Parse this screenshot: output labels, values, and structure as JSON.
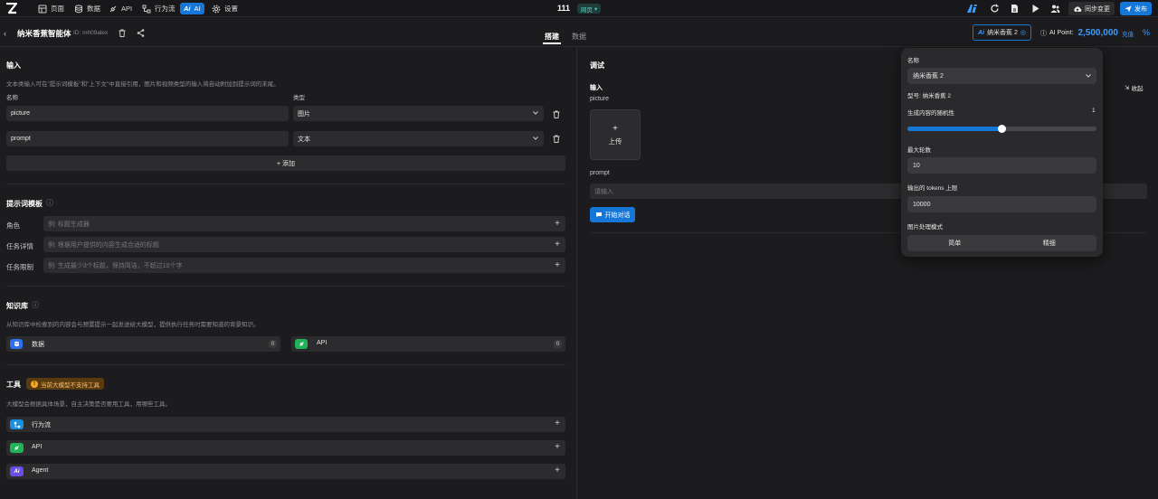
{
  "topbar": {
    "nav": [
      {
        "label": "页面",
        "icon": "pages-icon"
      },
      {
        "label": "数据",
        "icon": "database-icon"
      },
      {
        "label": "API",
        "icon": "api-icon"
      },
      {
        "label": "行为流",
        "icon": "workflow-icon"
      },
      {
        "label": "AI",
        "icon": "ai-icon"
      },
      {
        "label": "设置",
        "icon": "gear-icon"
      }
    ],
    "project": "111",
    "env_tag": "网页",
    "sync_label": "同步变更",
    "publish_label": "发布"
  },
  "subbar": {
    "agent_name": "纳米香蕉智能体",
    "agent_id": "ID: mh09alex",
    "tabs": [
      "搭建",
      "数据"
    ],
    "model_button": "纳米香蕉 2",
    "ai_point_label": "AI Point:",
    "ai_point_value": "2,500,000",
    "recharge": "充值"
  },
  "input_section": {
    "title": "输入",
    "desc": "文本类输入可在\"提示词模板\"和\"上下文\"中直接引用，图片和视频类型的输入将自动附加到提示词的末尾。",
    "col_name": "名称",
    "col_type": "类型",
    "rows": [
      {
        "name": "picture",
        "type": "图片"
      },
      {
        "name": "prompt",
        "type": "文本"
      }
    ],
    "add_label": "+ 添加"
  },
  "prompt_section": {
    "title": "提示词模板",
    "rows": [
      {
        "label": "角色",
        "placeholder": "例: 标题生成器"
      },
      {
        "label": "任务详情",
        "placeholder": "例: 根据用户提供的内容生成合适的标题"
      },
      {
        "label": "任务限制",
        "placeholder": "例: 生成最少3个标题，保持简洁，不超过10个字"
      }
    ]
  },
  "kb_section": {
    "title": "知识库",
    "desc": "从知识库中检索到的内容会与预置提示一起发送给大模型，提供执行任务时需要知道的背景知识。",
    "items": [
      {
        "label": "数据",
        "count": "0"
      },
      {
        "label": "API",
        "count": "0"
      }
    ]
  },
  "tools_section": {
    "title": "工具",
    "warning": "当前大模型不支持工具",
    "desc": "大模型会根据具体场景，自主决策是否要用工具，用哪些工具。",
    "items": [
      {
        "label": "行为流"
      },
      {
        "label": "API"
      },
      {
        "label": "Agent"
      }
    ]
  },
  "debug": {
    "title": "调试",
    "collapse": "收起",
    "input_label": "输入",
    "picture_label": "picture",
    "upload_label": "上传",
    "prompt_label": "prompt",
    "prompt_placeholder": "请输入",
    "start_label": "开始对话"
  },
  "popup": {
    "name_label": "名称",
    "name_value": "纳米香蕉 2",
    "model_line": "型号: 纳米香蕉 2",
    "randomness_label": "生成内容的随机性",
    "randomness_value": "1",
    "randomness_fraction": 0.5,
    "max_rounds_label": "最大轮数",
    "max_rounds_value": "10",
    "max_tokens_label": "输出的 tokens 上限",
    "max_tokens_value": "10000",
    "image_mode_label": "图片处理模式",
    "image_modes": [
      "简单",
      "精细"
    ]
  },
  "colors": {
    "accent": "#1677d9",
    "background": "#1c1c1e",
    "field": "#2c2c2e"
  }
}
